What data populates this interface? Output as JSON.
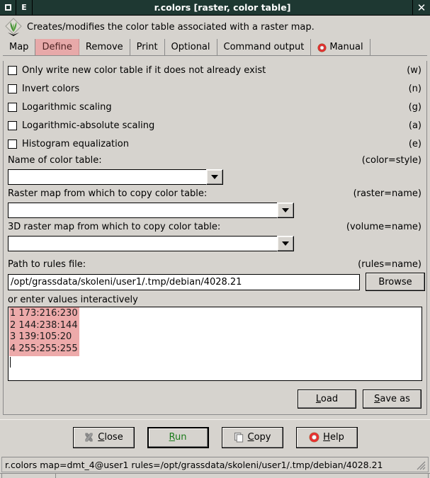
{
  "window": {
    "title": "r.colors [raster, color table]",
    "menu_button_icon": "maximize-icon",
    "edit_button_label": "E",
    "close_label": "✕"
  },
  "header": {
    "description": "Creates/modifies the color table associated with a raster map.",
    "logo_icon": "grass-logo-icon"
  },
  "tabs": [
    {
      "label": "Map",
      "selected": false,
      "icon": ""
    },
    {
      "label": "Define",
      "selected": true,
      "icon": ""
    },
    {
      "label": "Remove",
      "selected": false,
      "icon": ""
    },
    {
      "label": "Print",
      "selected": false,
      "icon": ""
    },
    {
      "label": "Optional",
      "selected": false,
      "icon": ""
    },
    {
      "label": "Command output",
      "selected": false,
      "icon": ""
    },
    {
      "label": "Manual",
      "selected": false,
      "icon": "lifebuoy-icon"
    }
  ],
  "checkboxes": [
    {
      "label": "Only write new color table if it does not already exist",
      "hint": "(w)",
      "checked": false
    },
    {
      "label": "Invert colors",
      "hint": "(n)",
      "checked": false
    },
    {
      "label": "Logarithmic scaling",
      "hint": "(g)",
      "checked": false
    },
    {
      "label": "Logarithmic-absolute scaling",
      "hint": "(a)",
      "checked": false
    },
    {
      "label": "Histogram equalization",
      "hint": "(e)",
      "checked": false
    }
  ],
  "fields": {
    "color_table": {
      "label": "Name of color table:",
      "hint": "(color=style)",
      "value": "",
      "placeholder": ""
    },
    "raster_map": {
      "label": "Raster map from which to copy color table:",
      "hint": "(raster=name)",
      "value": "",
      "placeholder": ""
    },
    "raster_3d_map": {
      "label": "3D raster map from which to copy color table:",
      "hint": "(volume=name)",
      "value": "",
      "placeholder": ""
    },
    "rules_path": {
      "label": "Path to rules file:",
      "hint": "(rules=name)",
      "value": "/opt/grassdata/skoleni/user1/.tmp/debian/4028.21",
      "placeholder": "",
      "browse_label": "Browse"
    }
  },
  "rules_editor": {
    "label": "or enter values interactively",
    "lines": [
      "1 173:216:230",
      "2 144:238:144",
      "3 139:105:20",
      "4 255:255:255"
    ],
    "selection_color": "#edaaaa"
  },
  "panel_buttons": {
    "load": "Load",
    "load_accelerator": "L",
    "save_as": "Save as",
    "save_as_accelerator": "S"
  },
  "bottom_buttons": [
    {
      "label": "Close",
      "accelerator": "C",
      "icon": "close-x-icon",
      "default": false,
      "green": false
    },
    {
      "label": "Run",
      "accelerator": "R",
      "icon": "",
      "default": true,
      "green": true
    },
    {
      "label": "Copy",
      "accelerator": "C",
      "icon": "copy-pages-icon",
      "default": false,
      "green": false
    },
    {
      "label": "Help",
      "accelerator": "H",
      "icon": "lifebuoy-icon",
      "default": false,
      "green": false
    }
  ],
  "statusbar": {
    "command": "r.colors map=dmt_4@user1 rules=/opt/grassdata/skoleni/user1/.tmp/debian/4028.21",
    "grip_icon": "resize-grip-icon"
  },
  "colors": {
    "titlebar_bg": "#1e3832",
    "window_bg": "#d6d3ce",
    "tab_selected_bg": "#e7a9a9",
    "tab_selected_text": "#4d2222",
    "run_text": "#1a7a1a",
    "selection_pink": "#edaaaa"
  }
}
